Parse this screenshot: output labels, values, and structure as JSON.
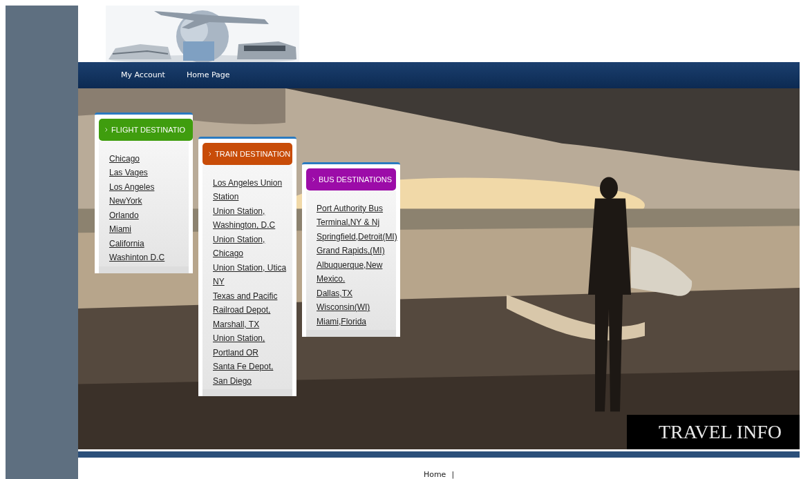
{
  "nav": {
    "items": [
      {
        "label": "My Account"
      },
      {
        "label": "Home Page"
      }
    ]
  },
  "hero": {
    "kind": "picture",
    "caption": "TRAVEL INFO"
  },
  "panels": [
    {
      "title": "FLIGHT DESTINATIO",
      "color": "#3f9d0e",
      "links": [
        "Chicago",
        "Las Vages",
        "Los Angeles",
        "NewYork",
        "Orlando",
        "Miami",
        "California",
        "Washinton D.C"
      ]
    },
    {
      "title": "TRAIN DESTINATION",
      "color": "#c84c08",
      "links": [
        "Los Angeles Union Station",
        "Union Station, Washington, D.C",
        "Union Station, Chicago",
        "Union Station, Utica NY",
        "Texas and Pacific Railroad Depot, Marshall, TX",
        "Union Station, Portland OR",
        "Santa Fe Depot, San Diego"
      ]
    },
    {
      "title": "BUS DESTINATIONS",
      "color": "#9c0ca8",
      "links": [
        "Port Authority Bus Terminal,NY & Nj",
        "Springfield,Detroit(MI)",
        "Grand Rapids,(MI)",
        "Albuquerque,New Mexico.",
        "Dallas,TX",
        "Wisconsin(WI)",
        "Miami,Florida"
      ]
    }
  ],
  "footer": {
    "link": "Home",
    "separator": "|"
  }
}
